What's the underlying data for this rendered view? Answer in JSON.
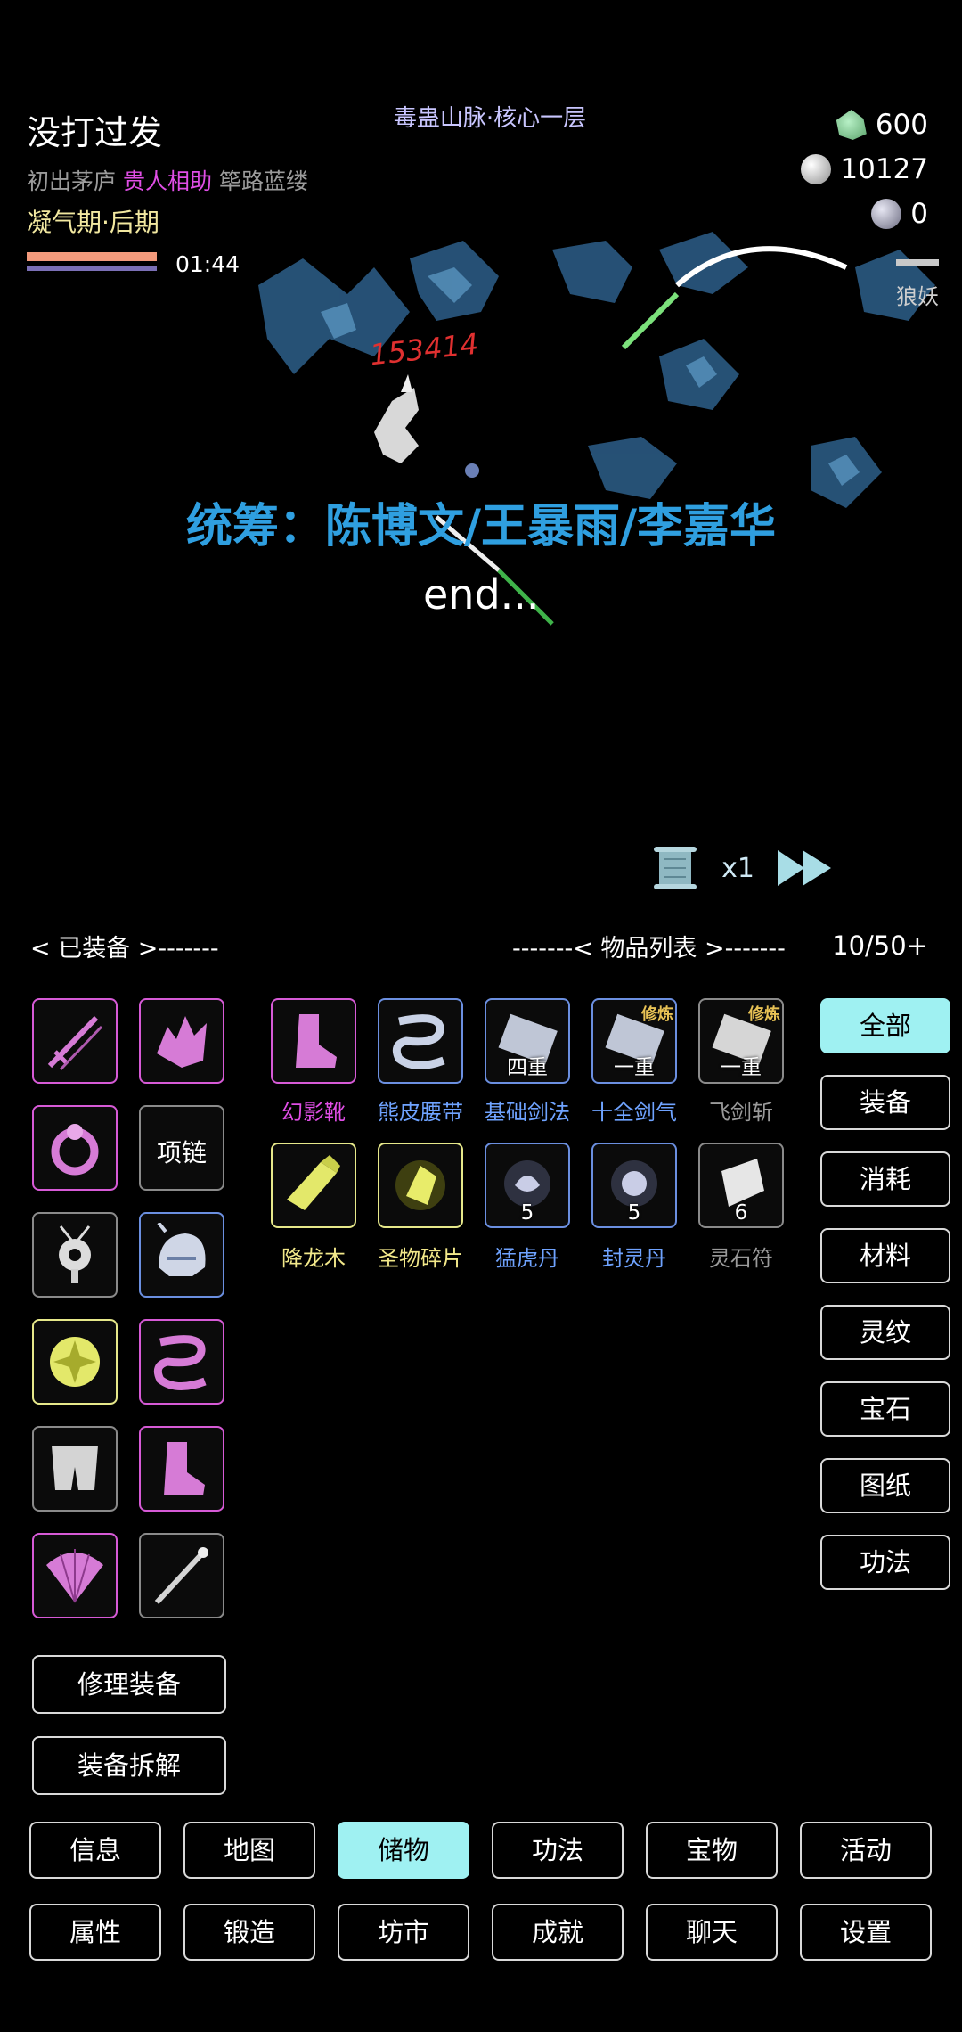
{
  "header": {
    "player_name": "没打过发",
    "tags": [
      "初出茅庐",
      "贵人相助",
      "筚路蓝缕"
    ],
    "realm": "凝气期·后期",
    "timer": "01:44",
    "location": "毒蛊山脉·核心一层",
    "currencies": [
      {
        "icon": "jade-icon",
        "value": "600"
      },
      {
        "icon": "silver-coin-icon",
        "value": "10127"
      },
      {
        "icon": "spirit-stone-icon",
        "value": "0"
      }
    ]
  },
  "battle": {
    "credit_text": "统筹：陈博文/王暴雨/李嘉华",
    "end_text": "end...",
    "damage_text": "153414",
    "enemy_label": "狼妖",
    "speed_label": "x1"
  },
  "equipped": {
    "header": "< 已装备 >-------",
    "slots": [
      {
        "name": "sword",
        "quality": "pink"
      },
      {
        "name": "spiked-armor",
        "quality": "pink"
      },
      {
        "name": "ring",
        "quality": "pink"
      },
      {
        "name": "necklace",
        "quality": "gray",
        "label": "项链"
      },
      {
        "name": "amulet",
        "quality": "gray"
      },
      {
        "name": "helmet",
        "quality": "blue"
      },
      {
        "name": "talisman",
        "quality": "yellow"
      },
      {
        "name": "serpent-belt",
        "quality": "pink"
      },
      {
        "name": "cloth-leggings",
        "quality": "gray"
      },
      {
        "name": "boots",
        "quality": "pink"
      },
      {
        "name": "fan",
        "quality": "pink"
      },
      {
        "name": "staff",
        "quality": "gray"
      }
    ],
    "repair_label": "修理装备",
    "dismantle_label": "装备拆解"
  },
  "inventory": {
    "header": "-------< 物品列表 >-------",
    "capacity": "10/50+",
    "items": [
      {
        "name": "幻影靴",
        "quality": "pink",
        "color": "#e04ee6"
      },
      {
        "name": "熊皮腰带",
        "quality": "blue",
        "color": "#6fa3ff"
      },
      {
        "name": "基础剑法",
        "quality": "blue",
        "color": "#6fa3ff",
        "badge": "四重"
      },
      {
        "name": "十全剑气",
        "quality": "blue",
        "color": "#6fa3ff",
        "badge": "一重",
        "ribbon": "修炼"
      },
      {
        "name": "飞剑斩",
        "quality": "gray",
        "color": "#9a9a9a",
        "badge": "一重",
        "ribbon": "修炼"
      },
      {
        "name": "降龙木",
        "quality": "yellow",
        "color": "#f2e88a"
      },
      {
        "name": "圣物碎片",
        "quality": "yellow",
        "color": "#f2e88a"
      },
      {
        "name": "猛虎丹",
        "quality": "blue",
        "color": "#6fa3ff",
        "badge": "5"
      },
      {
        "name": "封灵丹",
        "quality": "blue",
        "color": "#6fa3ff",
        "badge": "5"
      },
      {
        "name": "灵石符",
        "quality": "gray",
        "color": "#9a9a9a",
        "badge": "6"
      }
    ]
  },
  "filters": [
    "全部",
    "装备",
    "消耗",
    "材料",
    "灵纹",
    "宝石",
    "图纸",
    "功法"
  ],
  "active_filter": 0,
  "nav_row1": [
    "信息",
    "地图",
    "储物",
    "功法",
    "宝物",
    "活动"
  ],
  "nav_row2": [
    "属性",
    "锻造",
    "坊市",
    "成就",
    "聊天",
    "设置"
  ],
  "active_nav": "储物",
  "colors": {
    "accent": "#9ff1f2",
    "pink": "#d65ad6",
    "blue": "#6b8fe0",
    "yellow": "#e6e88a"
  }
}
